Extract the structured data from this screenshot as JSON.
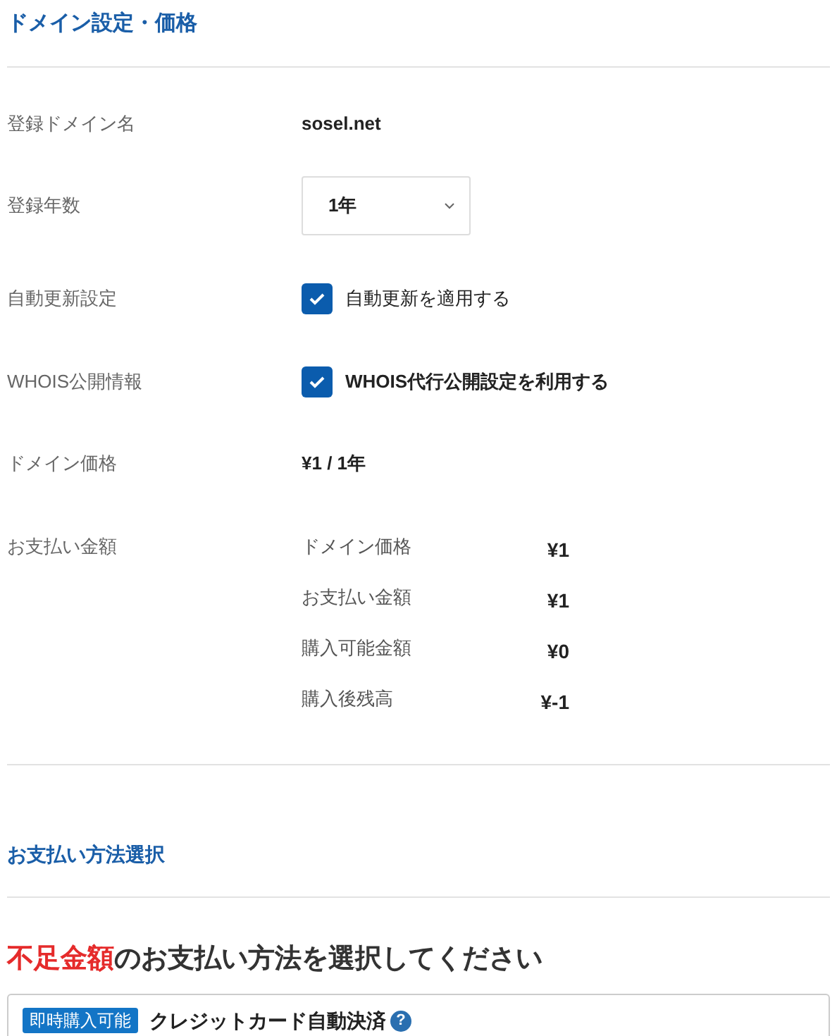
{
  "section_title": "ドメイン設定・価格",
  "rows": [
    {
      "kind": "text",
      "label": "登録ドメイン名",
      "value": "sosel.net"
    },
    {
      "kind": "select",
      "label": "登録年数",
      "value": "1年"
    },
    {
      "kind": "checkbox",
      "label": "自動更新設定",
      "option": "自動更新を適用する",
      "checked": true,
      "bold": false
    },
    {
      "kind": "checkbox",
      "label": "WHOIS公開情報",
      "option": "WHOIS代行公開設定を利用する",
      "checked": true,
      "bold": true
    },
    {
      "kind": "text",
      "label": "ドメイン価格",
      "value": "¥1 / 1年"
    },
    {
      "kind": "summary",
      "label": "お支払い金額",
      "lines": [
        {
          "label": "ドメイン価格",
          "amount": "¥1"
        },
        {
          "label": "お支払い金額",
          "amount": "¥1"
        },
        {
          "label": "購入可能金額",
          "amount": "¥0"
        },
        {
          "label": "購入後残高",
          "amount": "¥-1"
        }
      ]
    }
  ],
  "payment_title": "お支払い方法選択",
  "prompt": {
    "highlight": "不足金額",
    "rest": "のお支払い方法を選択してください"
  },
  "method": {
    "badge": "即時購入可能",
    "name": "クレジットカード自動決済",
    "help": "?"
  }
}
